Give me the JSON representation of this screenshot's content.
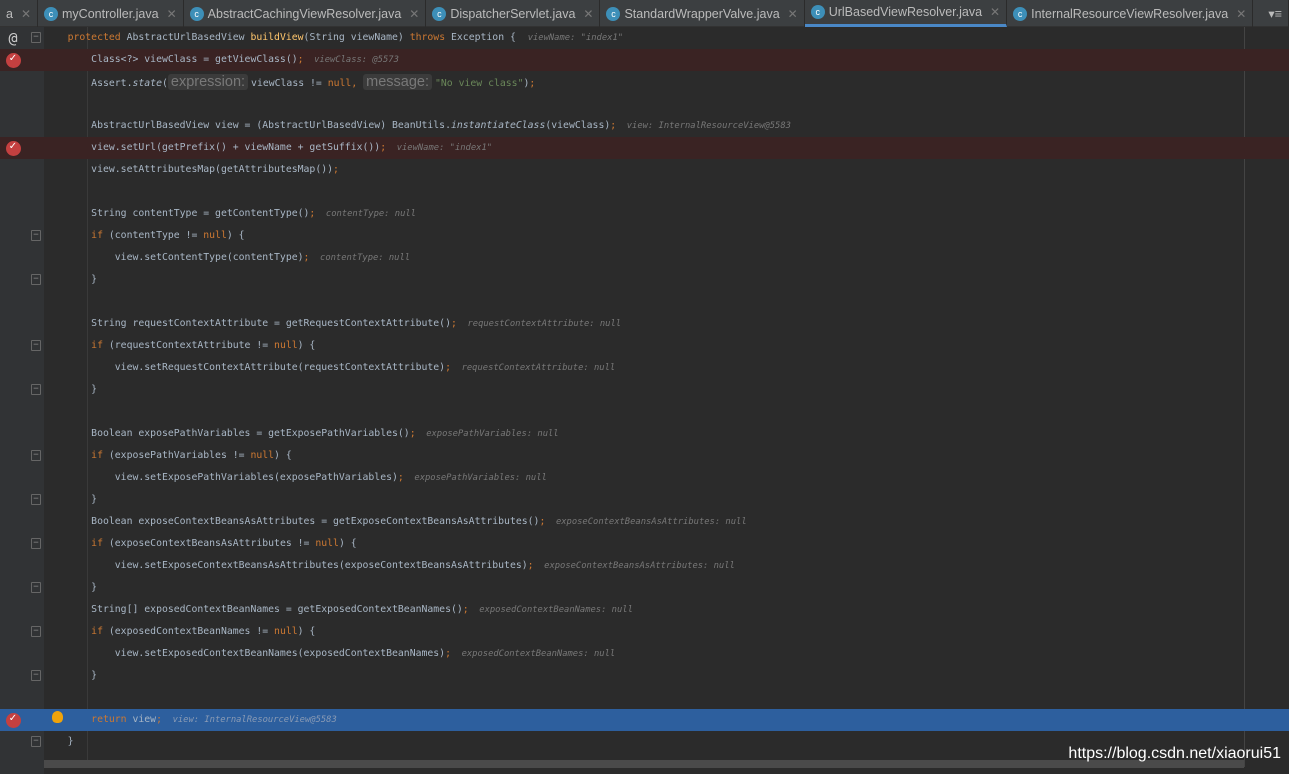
{
  "tabs": [
    {
      "label": "a",
      "partial": true
    },
    {
      "label": "myController.java"
    },
    {
      "label": "AbstractCachingViewResolver.java"
    },
    {
      "label": "DispatcherServlet.java"
    },
    {
      "label": "StandardWrapperValve.java"
    },
    {
      "label": "UrlBasedViewResolver.java",
      "active": true
    },
    {
      "label": "InternalResourceViewResolver.java"
    }
  ],
  "tab_overflow_icon": "tab-list-icon",
  "colors": {
    "background": "#2b2b2b",
    "keyword": "#cc7832",
    "method": "#ffc66d",
    "string": "#6a8759",
    "breakpoint_line": "#3a2323",
    "execution_line": "#2d5f9e"
  },
  "lines": [
    {
      "gutter": "at",
      "fold": true,
      "t": [
        [
          "txt",
          "    "
        ],
        [
          "kw",
          "protected "
        ],
        [
          "txt",
          "AbstractUrlBasedView "
        ],
        [
          "fn",
          "buildView"
        ],
        [
          "txt",
          "(String viewName) "
        ],
        [
          "kw",
          "throws "
        ],
        [
          "txt",
          "Exception {  "
        ],
        [
          "hint",
          "viewName: \"index1\""
        ]
      ]
    },
    {
      "gutter": "bp",
      "bg": "bp",
      "t": [
        [
          "txt",
          "        Class<?> viewClass = getViewClass()"
        ],
        [
          "kw",
          ";"
        ],
        [
          "hint",
          "  viewClass: @5573"
        ]
      ]
    },
    {
      "t": [
        [
          "txt",
          "        Assert."
        ],
        [
          "it",
          "state"
        ],
        [
          "txt",
          "("
        ],
        [
          "ph",
          "expression:"
        ],
        [
          "txt",
          "viewClass != "
        ],
        [
          "kw",
          "null, "
        ],
        [
          "ph",
          "message:"
        ],
        [
          "str",
          "\"No view class\""
        ],
        [
          "txt",
          ")"
        ],
        [
          "kw",
          ";"
        ]
      ]
    },
    {
      "t": []
    },
    {
      "t": [
        [
          "txt",
          "        AbstractUrlBasedView view = (AbstractUrlBasedView) BeanUtils."
        ],
        [
          "it",
          "instantiateClass"
        ],
        [
          "txt",
          "(viewClass)"
        ],
        [
          "kw",
          ";"
        ],
        [
          "hint",
          "  view: InternalResourceView@5583"
        ]
      ]
    },
    {
      "gutter": "bp",
      "bg": "bp",
      "t": [
        [
          "txt",
          "        view.setUrl(getPrefix() + viewName + getSuffix())"
        ],
        [
          "kw",
          ";"
        ],
        [
          "hint",
          "  viewName: \"index1\""
        ]
      ]
    },
    {
      "t": [
        [
          "txt",
          "        view.setAttributesMap(getAttributesMap())"
        ],
        [
          "kw",
          ";"
        ]
      ]
    },
    {
      "t": []
    },
    {
      "t": [
        [
          "txt",
          "        String contentType = getContentType()"
        ],
        [
          "kw",
          ";"
        ],
        [
          "hint",
          "  contentType: null"
        ]
      ]
    },
    {
      "fold": true,
      "t": [
        [
          "kw",
          "        if "
        ],
        [
          "txt",
          "(contentType != "
        ],
        [
          "kw",
          "null"
        ],
        [
          "txt",
          ") {"
        ]
      ]
    },
    {
      "t": [
        [
          "txt",
          "            view.setContentType(contentType)"
        ],
        [
          "kw",
          ";"
        ],
        [
          "hint",
          "  contentType: null"
        ]
      ]
    },
    {
      "fold": true,
      "t": [
        [
          "txt",
          "        }"
        ]
      ]
    },
    {
      "t": []
    },
    {
      "t": [
        [
          "txt",
          "        String requestContextAttribute = getRequestContextAttribute()"
        ],
        [
          "kw",
          ";"
        ],
        [
          "hint",
          "  requestContextAttribute: null"
        ]
      ]
    },
    {
      "fold": true,
      "t": [
        [
          "kw",
          "        if "
        ],
        [
          "txt",
          "(requestContextAttribute != "
        ],
        [
          "kw",
          "null"
        ],
        [
          "txt",
          ") {"
        ]
      ]
    },
    {
      "t": [
        [
          "txt",
          "            view.setRequestContextAttribute(requestContextAttribute)"
        ],
        [
          "kw",
          ";"
        ],
        [
          "hint",
          "  requestContextAttribute: null"
        ]
      ]
    },
    {
      "fold": true,
      "t": [
        [
          "txt",
          "        }"
        ]
      ]
    },
    {
      "t": []
    },
    {
      "t": [
        [
          "txt",
          "        Boolean exposePathVariables = getExposePathVariables()"
        ],
        [
          "kw",
          ";"
        ],
        [
          "hint",
          "  exposePathVariables: null"
        ]
      ]
    },
    {
      "fold": true,
      "t": [
        [
          "kw",
          "        if "
        ],
        [
          "txt",
          "(exposePathVariables != "
        ],
        [
          "kw",
          "null"
        ],
        [
          "txt",
          ") {"
        ]
      ]
    },
    {
      "t": [
        [
          "txt",
          "            view.setExposePathVariables(exposePathVariables)"
        ],
        [
          "kw",
          ";"
        ],
        [
          "hint",
          "  exposePathVariables: null"
        ]
      ]
    },
    {
      "fold": true,
      "t": [
        [
          "txt",
          "        }"
        ]
      ]
    },
    {
      "t": [
        [
          "txt",
          "        Boolean exposeContextBeansAsAttributes = getExposeContextBeansAsAttributes()"
        ],
        [
          "kw",
          ";"
        ],
        [
          "hint",
          "  exposeContextBeansAsAttributes: null"
        ]
      ]
    },
    {
      "fold": true,
      "t": [
        [
          "kw",
          "        if "
        ],
        [
          "txt",
          "(exposeContextBeansAsAttributes != "
        ],
        [
          "kw",
          "null"
        ],
        [
          "txt",
          ") {"
        ]
      ]
    },
    {
      "t": [
        [
          "txt",
          "            view.setExposeContextBeansAsAttributes(exposeContextBeansAsAttributes)"
        ],
        [
          "kw",
          ";"
        ],
        [
          "hint",
          "  exposeContextBeansAsAttributes: null"
        ]
      ]
    },
    {
      "fold": true,
      "t": [
        [
          "txt",
          "        }"
        ]
      ]
    },
    {
      "t": [
        [
          "txt",
          "        String[] exposedContextBeanNames = getExposedContextBeanNames()"
        ],
        [
          "kw",
          ";"
        ],
        [
          "hint",
          "  exposedContextBeanNames: null"
        ]
      ]
    },
    {
      "fold": true,
      "t": [
        [
          "kw",
          "        if "
        ],
        [
          "txt",
          "(exposedContextBeanNames != "
        ],
        [
          "kw",
          "null"
        ],
        [
          "txt",
          ") {"
        ]
      ]
    },
    {
      "t": [
        [
          "txt",
          "            view.setExposedContextBeanNames(exposedContextBeanNames)"
        ],
        [
          "kw",
          ";"
        ],
        [
          "hint",
          "  exposedContextBeanNames: null"
        ]
      ]
    },
    {
      "fold": true,
      "t": [
        [
          "txt",
          "        }"
        ]
      ]
    },
    {
      "t": []
    },
    {
      "gutter": "bp",
      "bg": "exec",
      "bulb": true,
      "t": [
        [
          "kw",
          "        return "
        ],
        [
          "txt",
          "view"
        ],
        [
          "kw",
          ";"
        ],
        [
          "hint",
          "  view: InternalResourceView@5583"
        ]
      ]
    },
    {
      "fold": true,
      "t": [
        [
          "txt",
          "    }"
        ]
      ]
    }
  ],
  "watermark": "https://blog.csdn.net/xiaorui51"
}
